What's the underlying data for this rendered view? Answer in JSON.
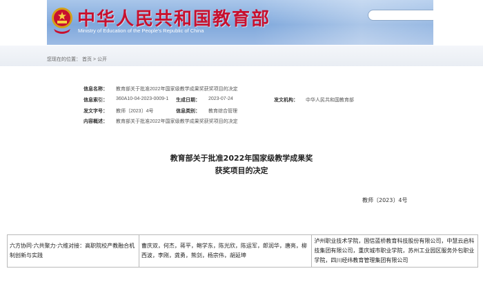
{
  "header": {
    "site_title": "中华人民共和国教育部",
    "site_subtitle": "Ministry of Education of the People's Republic of China",
    "colors": {
      "title_red": "#c8102e",
      "banner_blue": "#7fa8dc"
    },
    "emblem_icon": "national-emblem-icon",
    "search_icon": "search-icon"
  },
  "breadcrumb": {
    "prefix": "您现在的位置：",
    "home": "首页",
    "separator": ">",
    "current": "公开"
  },
  "meta": {
    "info_name_label": "信息名称：",
    "info_name": "教育部关于批准2022年国家级教学成果奖获奖项目的决定",
    "index_label": "信息索引：",
    "index": "360A10-04-2023-0009-1",
    "date_label": "生成日期：",
    "date": "2023-07-24",
    "issuer_label": "发文机构：",
    "issuer": "中华人民共和国教育部",
    "doc_no_label": "发文字号：",
    "doc_no": "教师〔2023〕4号",
    "category_label": "信息类别：",
    "category": "教育综合管理",
    "summary_label": "内容概述：",
    "summary": "教育部关于批准2022年国家级教学成果奖获奖项目的决定"
  },
  "document": {
    "title_line1": "教育部关于批准2022年国家级教学成果奖",
    "title_line2": "获奖项目的决定",
    "number": "教师〔2023〕4号"
  },
  "table": {
    "rows": [
      {
        "project": "六方协同·六共聚力·六维对接：高职院校产教融合机制创新与实践",
        "people": "曹庆双，何杰，蒋平，鲍学东，陈光欣，陈运军，郎润华，唐亮，柳西波，李刚，龚勇，熊剑，杨宗伟，胡延坤",
        "units": "泸州职业技术学院，国信蓝桥教育科技股份有限公司，中慧云启科技集团有限公司，重庆城市职业学院，苏州工业园区服务外包职业学院，四川经纬教育管理集团有限公司"
      }
    ]
  }
}
